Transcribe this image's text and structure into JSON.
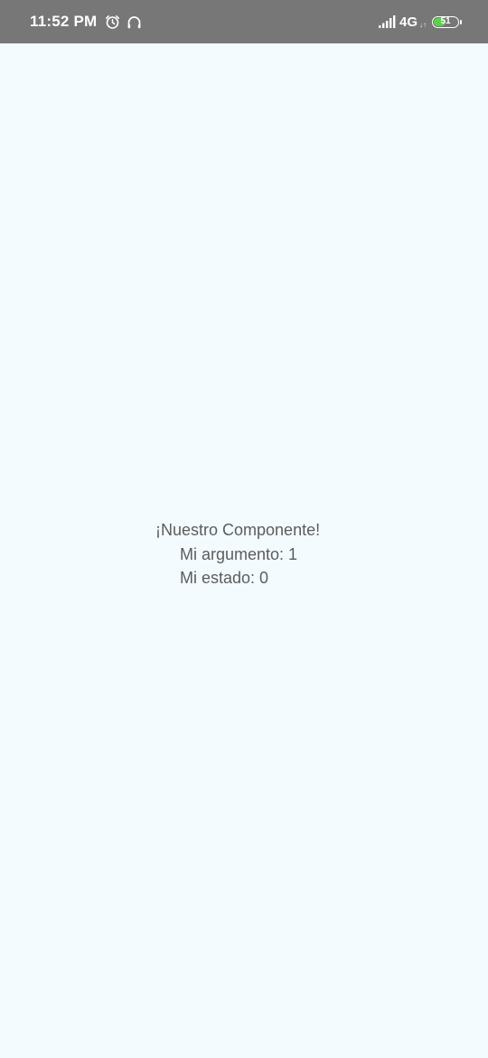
{
  "status_bar": {
    "time": "11:52 PM",
    "icons": [
      "alarm-icon",
      "headphones-icon",
      "signal-icon"
    ],
    "network": "4G",
    "network_arrows": "↓↑",
    "battery_level": "51",
    "battery_fraction": 0.51,
    "background_color": "#777777",
    "battery_color": "#5bd24a"
  },
  "screen": {
    "background_color": "#f3fbff",
    "text_color": "#5c5c5c"
  },
  "component": {
    "title": "¡Nuestro Componente!",
    "argument_text": "Mi argumento: 1",
    "state_text": "Mi estado: 0"
  }
}
